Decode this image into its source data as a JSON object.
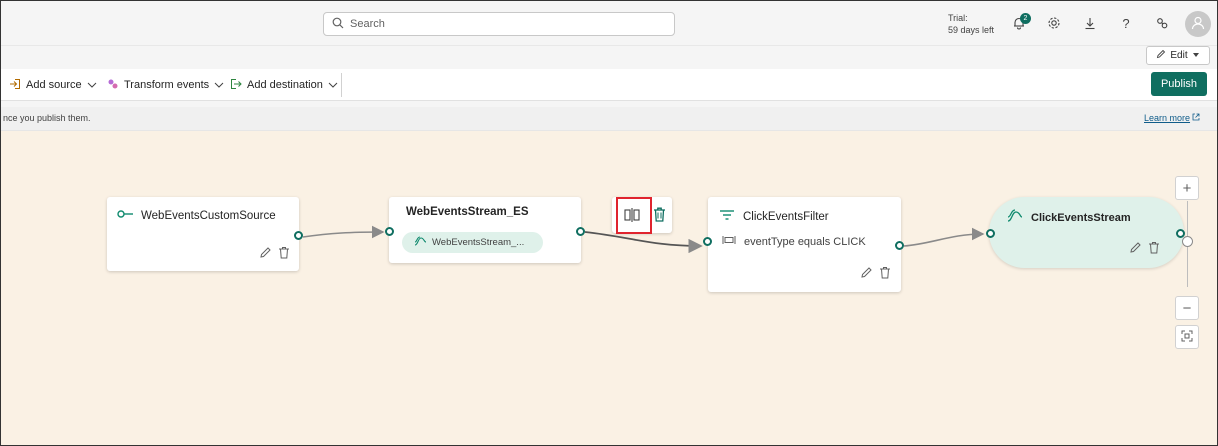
{
  "search": {
    "placeholder": "Search"
  },
  "trial": {
    "line1": "Trial:",
    "line2": "59 days left"
  },
  "notifications": {
    "count": "2"
  },
  "edit": {
    "label": "Edit"
  },
  "toolbar": {
    "add_source": "Add source",
    "transform_events": "Transform events",
    "add_destination": "Add destination",
    "publish": "Publish"
  },
  "info": {
    "text": "nce you publish them.",
    "learn_more": "Learn more"
  },
  "nodes": {
    "source": {
      "title": "WebEventsCustomSource"
    },
    "eventstream": {
      "title": "WebEventsStream_ES",
      "pill": "WebEventsStream_..."
    },
    "filter": {
      "title": "ClickEventsFilter",
      "condition": "eventType equals CLICK"
    },
    "destination": {
      "title": "ClickEventsStream"
    }
  },
  "zoom": {
    "in": "+",
    "out": "−"
  },
  "colors": {
    "accent": "#0f6e60",
    "canvas": "#faf1e4",
    "highlight": "#e0242e"
  },
  "icons": [
    "search-icon",
    "bell-icon",
    "gear-icon",
    "download-icon",
    "help-icon",
    "share-icon",
    "user-icon",
    "pencil-icon",
    "trash-icon",
    "split-icon",
    "filter-icon",
    "stream-icon",
    "source-icon",
    "fit-icon"
  ]
}
